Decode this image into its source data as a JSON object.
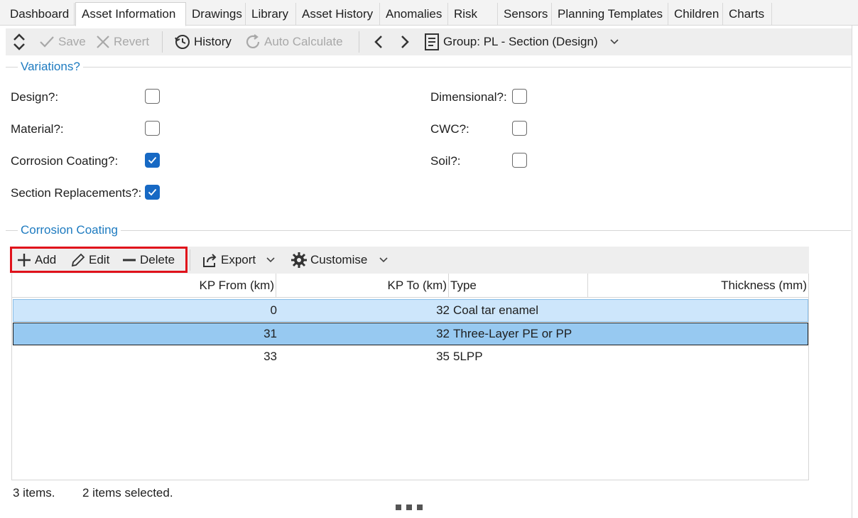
{
  "tabs": [
    {
      "label": "Dashboard"
    },
    {
      "label": "Asset Information"
    },
    {
      "label": "Drawings"
    },
    {
      "label": "Library"
    },
    {
      "label": "Asset History"
    },
    {
      "label": "Anomalies"
    },
    {
      "label": "Risk"
    },
    {
      "label": "Sensors"
    },
    {
      "label": "Planning Templates"
    },
    {
      "label": "Children"
    },
    {
      "label": "Charts"
    }
  ],
  "toolbar": {
    "save": "Save",
    "revert": "Revert",
    "history": "History",
    "auto_calculate": "Auto Calculate",
    "group": "Group: PL - Section (Design)"
  },
  "variations": {
    "title": "Variations?",
    "fields": [
      {
        "label": "Design?:",
        "checked": false
      },
      {
        "label": "Material?:",
        "checked": false
      },
      {
        "label": "Corrosion Coating?:",
        "checked": true
      },
      {
        "label": "Section Replacements?:",
        "checked": true
      },
      {
        "label": "Dimensional?:",
        "checked": false
      },
      {
        "label": "CWC?:",
        "checked": false
      },
      {
        "label": "Soil?:",
        "checked": false
      }
    ]
  },
  "coating": {
    "title": "Corrosion Coating",
    "toolbar": {
      "add": "Add",
      "edit": "Edit",
      "delete": "Delete",
      "export": "Export",
      "customise": "Customise"
    },
    "columns": [
      "KP From (km)",
      "KP To (km)",
      "Type",
      "Thickness (mm)"
    ],
    "rows": [
      {
        "kp_from": "0",
        "kp_to": "32",
        "type": "Coal tar enamel",
        "thickness": ""
      },
      {
        "kp_from": "31",
        "kp_to": "32",
        "type": "Three-Layer PE or PP",
        "thickness": ""
      },
      {
        "kp_from": "33",
        "kp_to": "35",
        "type": "5LPP",
        "thickness": ""
      }
    ],
    "status_count": "3 items.",
    "status_selected": "2 items selected."
  },
  "colors": {
    "accent": "#1e7bc0",
    "highlight": "#e0121b",
    "selection": "#97c9f1"
  }
}
